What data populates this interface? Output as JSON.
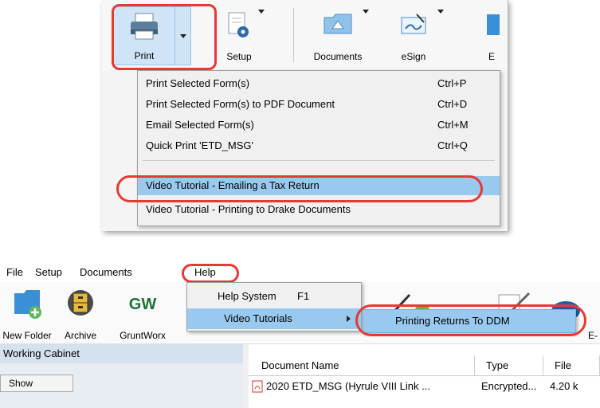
{
  "top": {
    "toolbar": {
      "print_label": "Print",
      "setup_label": "Setup",
      "documents_label": "Documents",
      "esign_label": "eSign",
      "partial_label": "E"
    },
    "print_menu": {
      "items": [
        {
          "label": "Print Selected Form(s)",
          "shortcut": "Ctrl+P"
        },
        {
          "label": "Print Selected Form(s) to PDF Document",
          "shortcut": "Ctrl+D"
        },
        {
          "label": "Email Selected Form(s)",
          "shortcut": "Ctrl+M"
        },
        {
          "label": "Quick Print 'ETD_MSG'",
          "shortcut": "Ctrl+Q"
        },
        {
          "label": "Video Tutorial - Emailing a Tax Return",
          "shortcut": ""
        },
        {
          "label": "Video Tutorial - Printing to Drake Documents",
          "shortcut": ""
        }
      ]
    }
  },
  "bottom": {
    "menubar": {
      "file": "File",
      "setup": "Setup",
      "documents": "Documents",
      "help": "Help"
    },
    "toolbar": {
      "new_folder": "New Folder",
      "archive": "Archive",
      "gruntworx": "GruntWorx",
      "gw_logo": "GW",
      "partial_e": "E-"
    },
    "help_menu": {
      "items": [
        {
          "label": "Help System",
          "shortcut": "F1"
        },
        {
          "label": "Video Tutorials",
          "shortcut": ""
        }
      ]
    },
    "submenu": {
      "item": "Printing Returns To DDM"
    },
    "left_pane": {
      "title": "Working Cabinet",
      "show_button": "Show"
    },
    "grid": {
      "headers": [
        "Document Name",
        "Type",
        "File"
      ],
      "rows": [
        {
          "name": "2020 ETD_MSG (Hyrule VIII Link ...",
          "type": "Encrypted...",
          "size": "4.20 k"
        }
      ]
    }
  },
  "colors": {
    "highlight": "#99c9ef",
    "annotation_red": "#e53935",
    "folder_blue": "#3b8fd6"
  }
}
